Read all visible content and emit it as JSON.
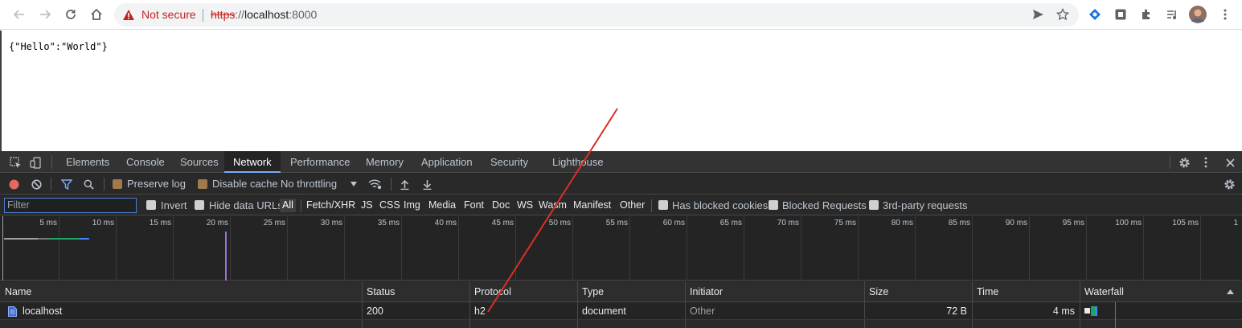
{
  "browser": {
    "security_label": "Not secure",
    "url_scheme": "https",
    "url_sep": "://",
    "url_host": "localhost",
    "url_port": ":8000"
  },
  "page": {
    "content": "{\"Hello\":\"World\"}"
  },
  "devtools": {
    "tabs": [
      "Elements",
      "Console",
      "Sources",
      "Network",
      "Performance",
      "Memory",
      "Application",
      "Security",
      "Lighthouse"
    ],
    "active_tab": "Network",
    "toolbar": {
      "preserve_log": "Preserve log",
      "disable_cache": "Disable cache",
      "throttling": "No throttling"
    },
    "filter": {
      "placeholder": "Filter",
      "invert": "Invert",
      "hide_data_urls": "Hide data URLs",
      "types": [
        "All",
        "Fetch/XHR",
        "JS",
        "CSS",
        "Img",
        "Media",
        "Font",
        "Doc",
        "WS",
        "Wasm",
        "Manifest",
        "Other"
      ],
      "has_blocked_cookies": "Has blocked cookies",
      "blocked_requests": "Blocked Requests",
      "third_party": "3rd-party requests"
    },
    "timeline_ticks": [
      "5 ms",
      "10 ms",
      "15 ms",
      "20 ms",
      "25 ms",
      "30 ms",
      "35 ms",
      "40 ms",
      "45 ms",
      "50 ms",
      "55 ms",
      "60 ms",
      "65 ms",
      "70 ms",
      "75 ms",
      "80 ms",
      "85 ms",
      "90 ms",
      "95 ms",
      "100 ms",
      "105 ms",
      "1"
    ],
    "table": {
      "headers": {
        "name": "Name",
        "status": "Status",
        "protocol": "Protocol",
        "type": "Type",
        "initiator": "Initiator",
        "size": "Size",
        "time": "Time",
        "waterfall": "Waterfall"
      },
      "rows": [
        {
          "name": "localhost",
          "status": "200",
          "protocol": "h2",
          "type": "document",
          "initiator": "Other",
          "size": "72 B",
          "time": "4 ms"
        }
      ]
    }
  },
  "colors": {
    "accent": "#7cacf8",
    "record": "#e46962",
    "annotation_line": "#d93025"
  }
}
